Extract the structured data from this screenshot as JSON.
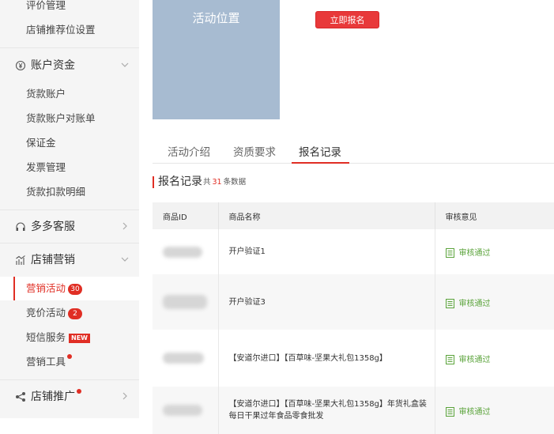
{
  "sidebar": {
    "top_items": [
      "评价管理",
      "店铺推荐位设置"
    ],
    "funds_group": {
      "label": "账户资金",
      "icon": "yen-circle-icon"
    },
    "funds_items": [
      "货款账户",
      "货款账户对账单",
      "保证金",
      "发票管理",
      "货款扣款明细"
    ],
    "service_group": {
      "label": "多多客服",
      "icon": "headset-icon"
    },
    "marketing_group": {
      "label": "店铺营销",
      "icon": "chart-icon"
    },
    "marketing_items": [
      {
        "label": "营销活动",
        "badge": "30"
      },
      {
        "label": "竞价活动",
        "badge": "2"
      },
      {
        "label": "短信服务",
        "badge": "NEW"
      },
      {
        "label": "营销工具"
      }
    ],
    "promo_group": {
      "label": "店铺推广",
      "icon": "share-icon"
    }
  },
  "activity": {
    "image_label": "活动位置",
    "signup_label": "立即报名"
  },
  "tabs": [
    "活动介绍",
    "资质要求",
    "报名记录"
  ],
  "records": {
    "title": "报名记录",
    "count_prefix": "共",
    "count": "31",
    "count_suffix": "条数据"
  },
  "table": {
    "headers": [
      "商品ID",
      "商品名称",
      "审核意见"
    ],
    "rows": [
      {
        "name": "开户验证1",
        "status": "审核通过"
      },
      {
        "name": "开户验证3",
        "status": "审核通过"
      },
      {
        "name": "【安道尔进口】【百草味-坚果大礼包1358g】",
        "status": "审核通过"
      },
      {
        "name": "【安道尔进口】【百草味-坚果大礼包1358g】年货礼盒装每日干果过年食品零食批发",
        "status": "审核通过"
      }
    ]
  },
  "colors": {
    "accent": "#e02e24",
    "approve": "#5aa33a",
    "activity_bg": "#a7bbd1"
  }
}
